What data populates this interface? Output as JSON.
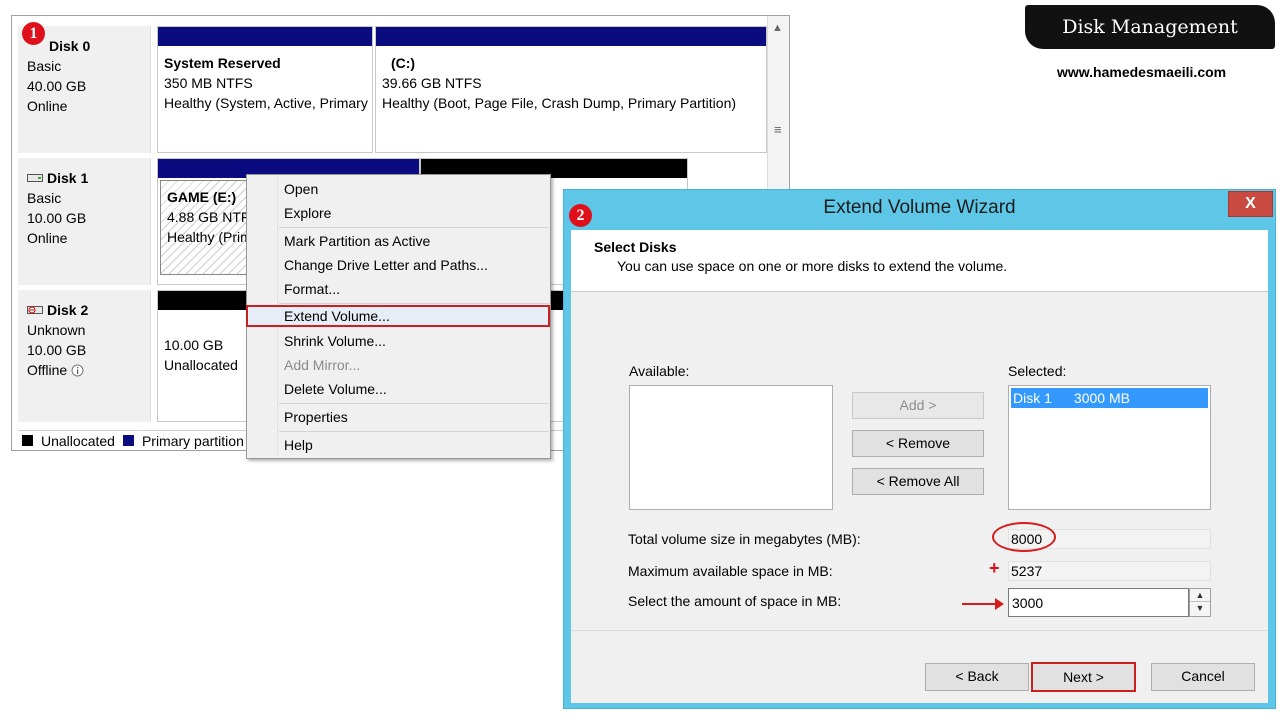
{
  "header": {
    "title": "Disk Management",
    "website": "www.hamedesmaeili.com"
  },
  "badges": [
    "1",
    "2"
  ],
  "disks": [
    {
      "name": "Disk 0",
      "type": "Basic",
      "size": "40.00 GB",
      "status": "Online",
      "partitions": [
        {
          "name": "System Reserved",
          "size": "350 MB NTFS",
          "status": "Healthy (System, Active, Primary Partition)",
          "bar_color": "#0b0b80"
        },
        {
          "name": "(C:)",
          "size": "39.66 GB NTFS",
          "status": "Healthy (Boot, Page File, Crash Dump, Primary Partition)",
          "bar_color": "#0b0b80"
        }
      ]
    },
    {
      "name": "Disk 1",
      "type": "Basic",
      "size": "10.00 GB",
      "status": "Online",
      "partitions": [
        {
          "name": "GAME  (E:)",
          "size": "4.88 GB NTFS",
          "status": "Healthy (Primary Partition)",
          "bar_color": "#0b0b80"
        }
      ]
    },
    {
      "name": "Disk 2",
      "type": "Unknown",
      "size": "10.00 GB",
      "status": "Offline",
      "partitions": [
        {
          "size": "10.00 GB",
          "status": "Unallocated",
          "bar_color": "#000000"
        }
      ]
    }
  ],
  "legend": [
    {
      "label": "Unallocated",
      "color": "#000000"
    },
    {
      "label": "Primary partition",
      "color": "#0b0b80"
    }
  ],
  "context_menu": {
    "items": [
      {
        "label": "Open",
        "enabled": true
      },
      {
        "label": "Explore",
        "enabled": true
      },
      {
        "label": "Mark Partition as Active",
        "enabled": true
      },
      {
        "label": "Change Drive Letter and Paths...",
        "enabled": true
      },
      {
        "label": "Format...",
        "enabled": true
      },
      {
        "label": "Extend Volume...",
        "enabled": true,
        "highlighted": true
      },
      {
        "label": "Shrink Volume...",
        "enabled": true
      },
      {
        "label": "Add Mirror...",
        "enabled": false
      },
      {
        "label": "Delete Volume...",
        "enabled": true
      },
      {
        "label": "Properties",
        "enabled": true
      },
      {
        "label": "Help",
        "enabled": true
      }
    ]
  },
  "wizard": {
    "title": "Extend Volume Wizard",
    "close_label": "X",
    "heading": "Select Disks",
    "subheading": "You can use space on one or more disks to extend the volume.",
    "available_label": "Available:",
    "selected_label": "Selected:",
    "selected_items": [
      {
        "disk": "Disk 1",
        "space": "3000 MB"
      }
    ],
    "buttons": {
      "add": "Add >",
      "remove": "< Remove",
      "remove_all": "< Remove All",
      "back": "< Back",
      "next": "Next >",
      "cancel": "Cancel"
    },
    "total_label": "Total volume size in megabytes (MB):",
    "total_value": "8000",
    "max_label": "Maximum available space in MB:",
    "max_value": "5237",
    "amount_label": "Select the amount of space in MB:",
    "amount_value": "3000",
    "plus_sign": "+"
  },
  "colors": {
    "accent_red": "#d71c1c",
    "wizard_frame": "#5ec6e6",
    "partition_blue": "#0b0b80",
    "selection": "#3399ff"
  }
}
